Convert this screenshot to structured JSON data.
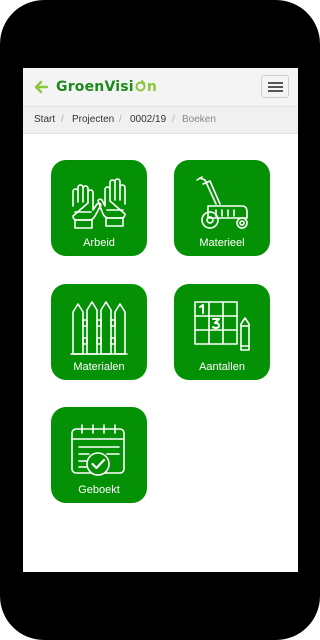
{
  "app": {
    "logo_part1": "Groen",
    "logo_part2": "Visi",
    "logo_part3": "n"
  },
  "colors": {
    "tile_green": "#059105",
    "logo_dark_green": "#1a8a1a",
    "logo_light_green": "#8cc63f"
  },
  "icons": {
    "back": "arrow-left-icon",
    "menu": "hamburger-menu-icon"
  },
  "breadcrumb": {
    "items": [
      "Start",
      "Projecten",
      "0002/19",
      "Boeken"
    ],
    "separator": "/"
  },
  "tiles": [
    {
      "label": "Arbeid",
      "icon": "gloves-icon"
    },
    {
      "label": "Materieel",
      "icon": "lawnmower-icon"
    },
    {
      "label": "Materialen",
      "icon": "fence-icon"
    },
    {
      "label": "Aantallen",
      "icon": "number-grid-icon"
    },
    {
      "label": "Geboekt",
      "icon": "calendar-check-icon"
    }
  ]
}
